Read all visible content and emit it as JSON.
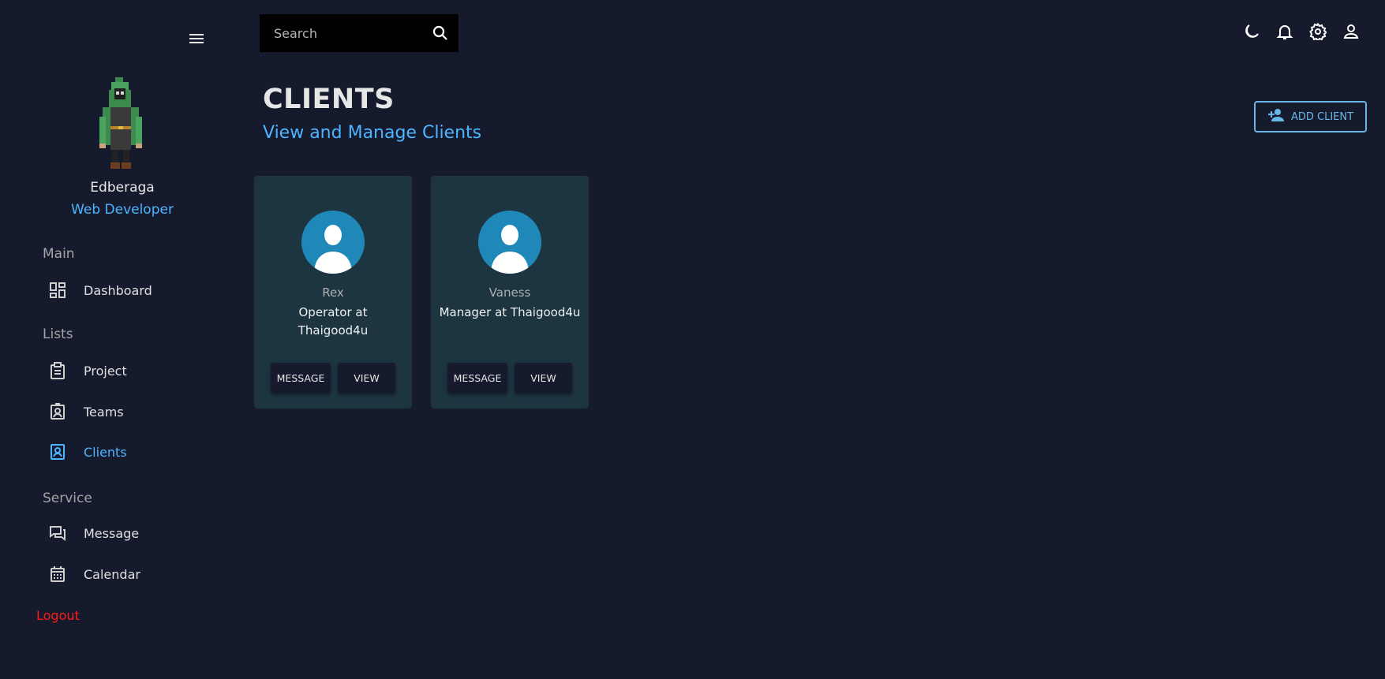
{
  "sidebar": {
    "user": {
      "name": "Edberaga",
      "role": "Web Developer"
    },
    "sections": [
      {
        "label": "Main"
      },
      {
        "label": "Lists"
      },
      {
        "label": "Service"
      }
    ],
    "items": [
      {
        "label": "Dashboard",
        "icon": "dashboard-icon"
      },
      {
        "label": "Project",
        "icon": "clipboard-icon"
      },
      {
        "label": "Teams",
        "icon": "contact-card-icon"
      },
      {
        "label": "Clients",
        "icon": "client-icon",
        "active": true
      },
      {
        "label": "Message",
        "icon": "chat-icon"
      },
      {
        "label": "Calendar",
        "icon": "calendar-icon"
      }
    ],
    "logout_label": "Logout"
  },
  "topbar": {
    "search_placeholder": "Search",
    "icons": [
      "moon-icon",
      "bell-icon",
      "gear-icon",
      "user-icon"
    ]
  },
  "header": {
    "title": "CLIENTS",
    "subtitle": "View and Manage Clients",
    "add_button_label": "ADD CLIENT"
  },
  "clients": [
    {
      "name": "Rex",
      "role": "Operator at Thaigood4u",
      "message_label": "MESSAGE",
      "view_label": "VIEW"
    },
    {
      "name": "Vaness",
      "role": "Manager at Thaigood4u",
      "message_label": "MESSAGE",
      "view_label": "VIEW"
    }
  ],
  "colors": {
    "background": "#151a2d",
    "accent": "#4db5ff",
    "card": "#1d3441",
    "logout": "#ff1a1a"
  }
}
